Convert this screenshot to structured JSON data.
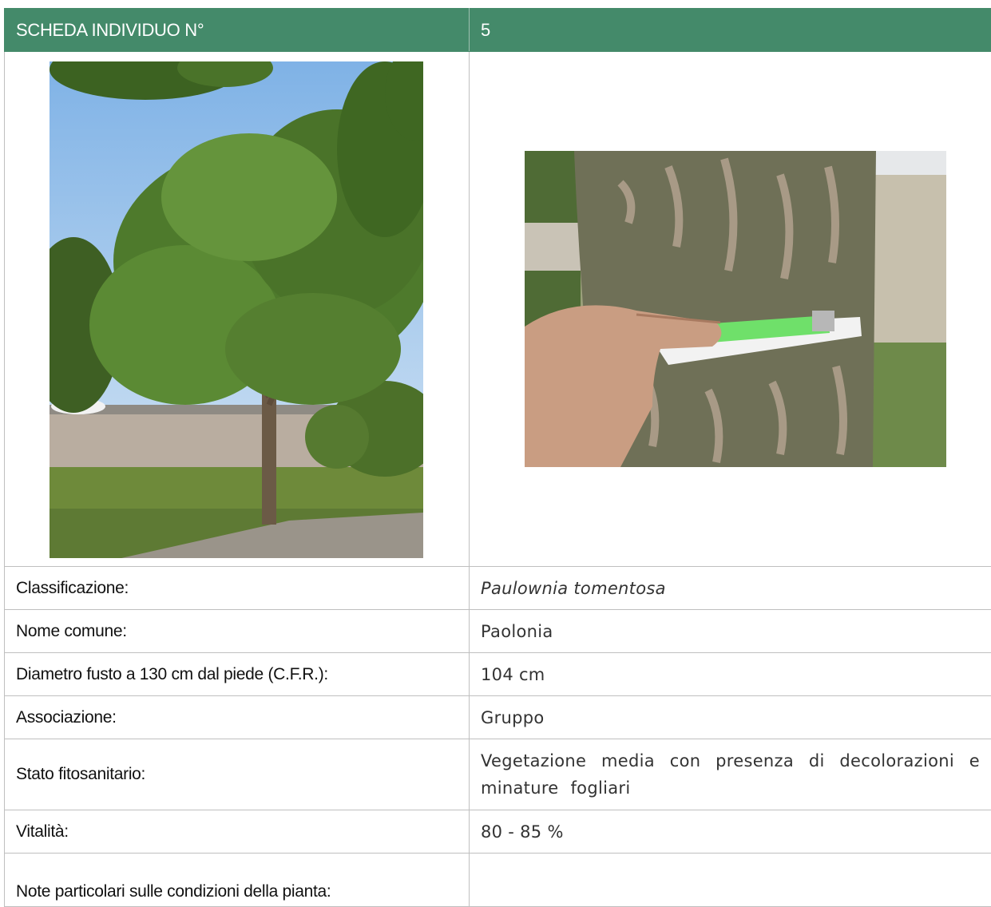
{
  "header": {
    "label": "SCHEDA INDIVIDUO N°",
    "number": "5"
  },
  "photos": {
    "tree": "tree-photo",
    "trunk": "trunk-measure-photo"
  },
  "rows": [
    {
      "label": "Classificazione:",
      "value": "Paulownia tomentosa"
    },
    {
      "label": "Nome comune:",
      "value": "Paolonia"
    },
    {
      "label": "Diametro fusto a 130 cm dal piede (C.F.R.):",
      "value": "104 cm"
    },
    {
      "label": "Associazione:",
      "value": "Gruppo"
    },
    {
      "label": "Stato fitosanitario:",
      "value": "Vegetazione media con presenza di decolorazioni e minature fogliari"
    },
    {
      "label": "Vitalità:",
      "value": "80 - 85 %"
    },
    {
      "label": "Note particolari sulle condizioni della pianta:",
      "value": ""
    }
  ],
  "colors": {
    "header_bg": "#448a6a",
    "border": "#bfbfbf"
  }
}
